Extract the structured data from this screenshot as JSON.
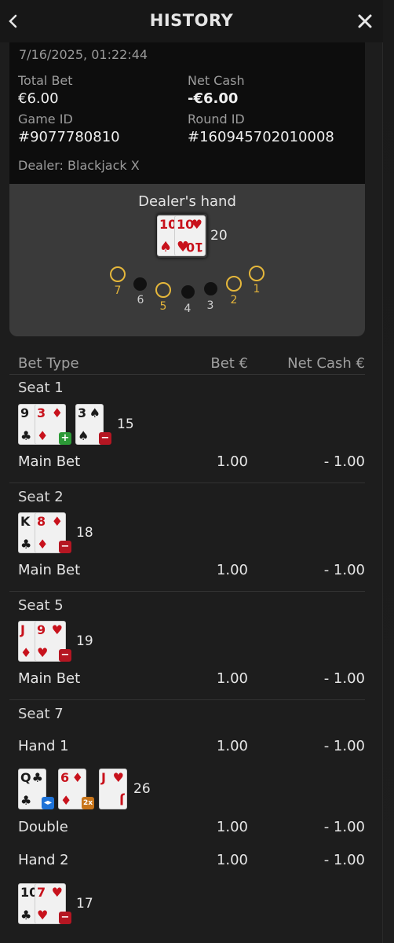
{
  "header": {
    "title": "HISTORY",
    "back_icon": "chevron-left-icon",
    "close_icon": "close-icon"
  },
  "summary": {
    "datetime": "7/16/2025, 01:22:44",
    "total_bet_label": "Total Bet",
    "total_bet_value": "€6.00",
    "net_cash_label": "Net Cash",
    "net_cash_value": "-€6.00",
    "game_id_label": "Game ID",
    "game_id_value": "#9077780810",
    "round_id_label": "Round ID",
    "round_id_value": "#160945702010008",
    "dealer": "Dealer: Blackjack X"
  },
  "dealer_hand": {
    "title": "Dealer's hand",
    "cards": [
      {
        "rank": "10",
        "suit": "♠",
        "color": "#c8121c"
      },
      {
        "rank": "10",
        "suit": "♥",
        "color": "#c8121c"
      }
    ],
    "total": "20"
  },
  "seat_map": [
    {
      "n": "7",
      "occupied": true
    },
    {
      "n": "6",
      "occupied": false
    },
    {
      "n": "5",
      "occupied": true
    },
    {
      "n": "4",
      "occupied": false
    },
    {
      "n": "3",
      "occupied": false
    },
    {
      "n": "2",
      "occupied": true
    },
    {
      "n": "1",
      "occupied": true
    }
  ],
  "table": {
    "col_bet_type": "Bet Type",
    "col_bet": "Bet €",
    "col_net": "Net Cash €"
  },
  "seats": [
    {
      "title": "Seat 1",
      "cards": [
        {
          "rank": "9",
          "suit": "♣",
          "red": false
        },
        {
          "rank": "3",
          "suit": "♦",
          "red": true,
          "badge": "+"
        },
        {
          "rank": "3",
          "suit": "♠",
          "red": false,
          "badge": "−"
        }
      ],
      "total": "15",
      "label": "Main Bet",
      "bet": "1.00",
      "net": "- 1.00"
    },
    {
      "title": "Seat 2",
      "cards": [
        {
          "rank": "K",
          "suit": "♣",
          "red": false
        },
        {
          "rank": "8",
          "suit": "♦",
          "red": true,
          "badge": "−"
        }
      ],
      "total": "18",
      "label": "Main Bet",
      "bet": "1.00",
      "net": "- 1.00"
    },
    {
      "title": "Seat 5",
      "cards": [
        {
          "rank": "J",
          "suit": "♦",
          "red": true
        },
        {
          "rank": "9",
          "suit": "♥",
          "red": true,
          "badge": "−"
        }
      ],
      "total": "19",
      "label": "Main Bet",
      "bet": "1.00",
      "net": "- 1.00"
    }
  ],
  "seat7": {
    "title": "Seat 7",
    "hand1": {
      "label": "Hand 1",
      "bet": "1.00",
      "net": "- 1.00",
      "cards": [
        {
          "rank": "Q",
          "suit": "♣",
          "red": false,
          "badge": "split"
        },
        {
          "rank": "6",
          "suit": "♦",
          "red": true,
          "badge": "2x"
        },
        {
          "rank": "J",
          "suit": "♥",
          "red": true
        }
      ],
      "total": "26",
      "double_label": "Double",
      "double_bet": "1.00",
      "double_net": "- 1.00"
    },
    "hand2": {
      "label": "Hand 2",
      "bet": "1.00",
      "net": "- 1.00",
      "cards": [
        {
          "rank": "10",
          "suit": "♣",
          "red": false
        },
        {
          "rank": "7",
          "suit": "♥",
          "red": true,
          "badge": "−"
        }
      ],
      "total": "17"
    }
  },
  "badge_text": {
    "plus": "+",
    "minus": "−",
    "split": "◂▸",
    "x2": "2x"
  }
}
